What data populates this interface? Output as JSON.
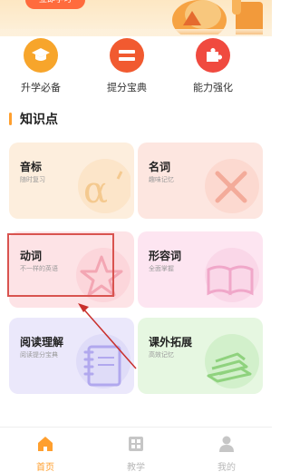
{
  "banner": {
    "pill_text": "立即学习"
  },
  "quick_entries": [
    {
      "label": "升学必备",
      "icon": "graduation-cap-icon",
      "color": "#f7a52b"
    },
    {
      "label": "提分宝典",
      "icon": "equals-icon",
      "color": "#f15a30"
    },
    {
      "label": "能力强化",
      "icon": "puzzle-icon",
      "color": "#f04a3f"
    }
  ],
  "section": {
    "title": "知识点"
  },
  "cards": [
    {
      "title": "音标",
      "subtitle": "随时复习",
      "bg": "#fdeedd",
      "art": "alpha-icon"
    },
    {
      "title": "名词",
      "subtitle": "趣味记忆",
      "bg": "#fde6e0",
      "art": "cross-icon"
    },
    {
      "title": "动词",
      "subtitle": "不一样的英语",
      "bg": "#fde3e6",
      "art": "star-icon"
    },
    {
      "title": "形容词",
      "subtitle": "全面掌握",
      "bg": "#fde5f1",
      "art": "book-icon"
    },
    {
      "title": "阅读理解",
      "subtitle": "阅读提分宝典",
      "bg": "#ebe8fb",
      "art": "notebook-icon"
    },
    {
      "title": "课外拓展",
      "subtitle": "高效记忆",
      "bg": "#e6f7e1",
      "art": "books-icon"
    }
  ],
  "tabbar": [
    {
      "label": "首页",
      "icon": "home-icon",
      "active": true
    },
    {
      "label": "教学",
      "icon": "grid-icon",
      "active": false
    },
    {
      "label": "我的",
      "icon": "user-icon",
      "active": false
    }
  ],
  "colors": {
    "accent": "#ff9f2e",
    "inactive": "#b8b8b8",
    "highlight": "#d9534f"
  }
}
